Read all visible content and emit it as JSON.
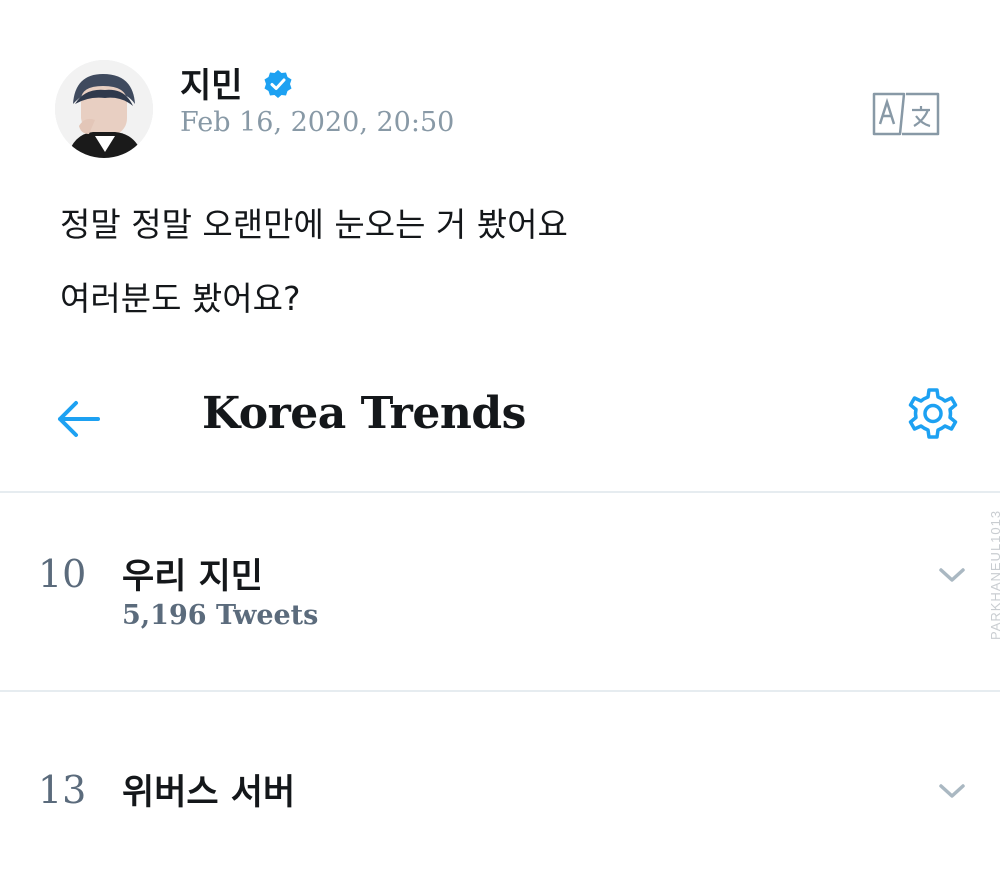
{
  "tweet": {
    "author_name": "지민",
    "timestamp": "Feb 16, 2020, 20:50",
    "text_lines": [
      "정말 정말 오랜만에 눈오는 거 봤어요",
      "여러분도 봤어요?"
    ],
    "avatar_icon": "profile-photo",
    "verified_icon": "verified-badge-icon",
    "translate_icon": "translate-icon"
  },
  "trends": {
    "title": "Korea Trends",
    "back_icon": "arrow-left-icon",
    "settings_icon": "gear-icon",
    "items": [
      {
        "rank": "10",
        "name": "우리 지민",
        "count": "5,196 Tweets"
      },
      {
        "rank": "13",
        "name": "위버스 서버",
        "count": ""
      }
    ]
  },
  "watermark": "PARKHANEUL1013",
  "colors": {
    "accent": "#1da1f2",
    "text_primary": "#14171a",
    "text_secondary": "#8899a6",
    "rank_gray": "#5b6b7c",
    "divider": "#e6ecf0",
    "chevron": "#aab8c2"
  }
}
